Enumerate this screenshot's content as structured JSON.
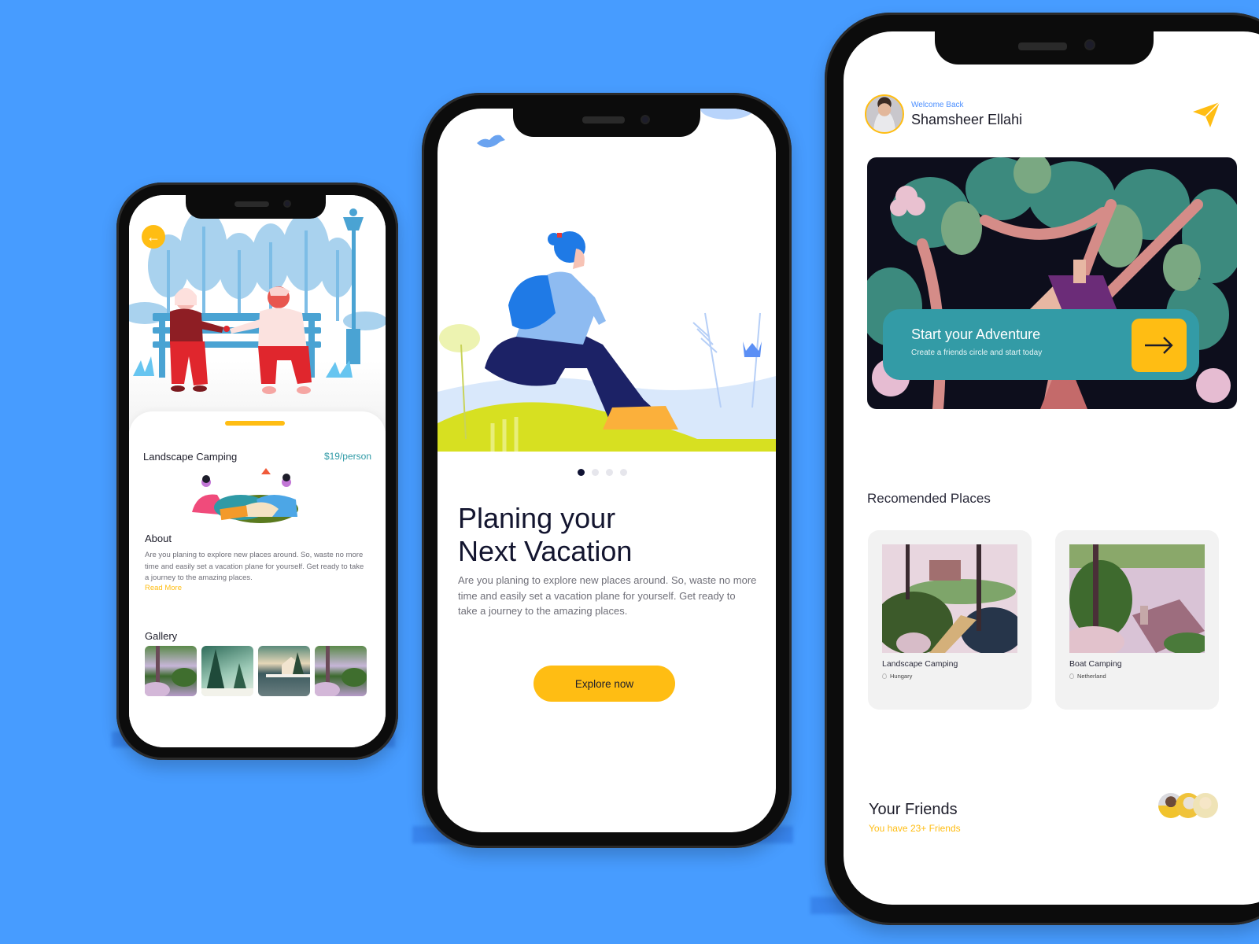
{
  "phone_left": {
    "back_icon": "arrow-left-icon",
    "place_title": "Landscape Camping",
    "price": "$19/person",
    "about_label": "About",
    "about_text": "Are you planing to explore new places around. So, waste no more time and easily set a vacation plane for yourself. Get ready to take a journey to the amazing places.",
    "read_more": "Read More",
    "gallery_label": "Gallery",
    "gallery": [
      {
        "name": "lake-garden"
      },
      {
        "name": "snowy-pines"
      },
      {
        "name": "lake-cabin"
      },
      {
        "name": "lake-garden-2"
      }
    ]
  },
  "phone_center": {
    "carousel": {
      "total": 4,
      "active": 1
    },
    "title_line1": "Planing your",
    "title_line2": "Next Vacation",
    "description": "Are you planing to explore new places around. So, waste no more time and easily set a vacation plane for yourself. Get ready to take a journey to the amazing places.",
    "cta_label": "Explore now"
  },
  "phone_right": {
    "welcome": "Welcome Back",
    "user_name": "Shamsheer Ellahi",
    "send_icon": "paper-plane-icon",
    "banner": {
      "title": "Start your Adventure",
      "subtitle": "Create a friends circle and start today",
      "button_icon": "arrow-right-icon"
    },
    "recommended_label": "Recomended Places",
    "places": [
      {
        "name": "Landscape Camping",
        "location": "Hungary"
      },
      {
        "name": "Boat Camping",
        "location": "Netherland"
      }
    ],
    "friends_label": "Your Friends",
    "friends_count_text": "You have 23+ Friends"
  },
  "colors": {
    "background": "#479cff",
    "accent_yellow": "#ffbd13",
    "teal": "#339ba6",
    "dark_text": "#13152f",
    "blue_text": "#4c8fff"
  }
}
